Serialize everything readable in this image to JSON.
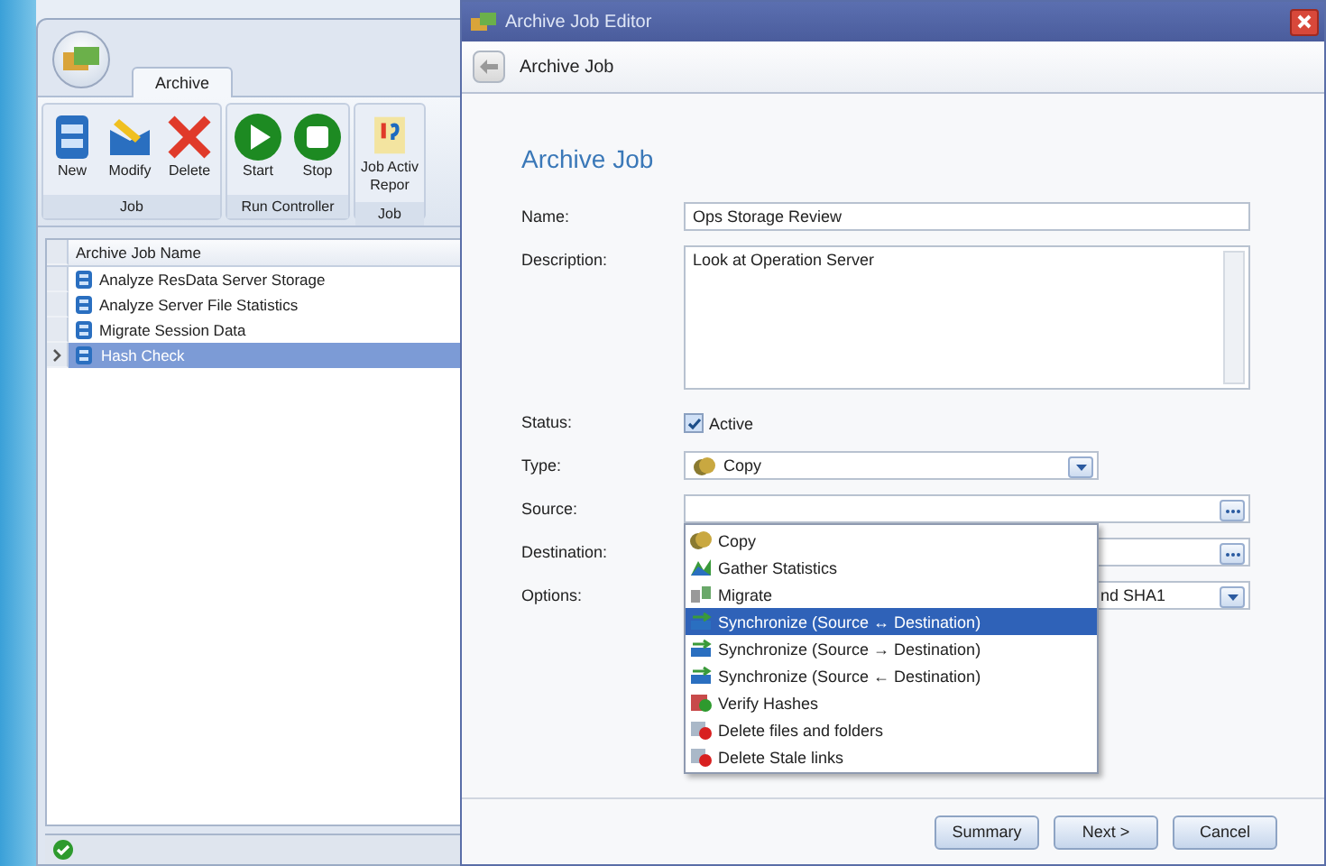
{
  "main_window": {
    "tab": {
      "label": "Archive",
      "selected": true
    },
    "ribbon_groups": [
      {
        "label": "Job",
        "buttons": [
          {
            "kind": "new",
            "lines": [
              "New"
            ]
          },
          {
            "kind": "modify",
            "lines": [
              "Modify"
            ]
          },
          {
            "kind": "delete",
            "lines": [
              "Delete"
            ]
          }
        ]
      },
      {
        "label": "Run Controller",
        "buttons": [
          {
            "kind": "start",
            "lines": [
              "Start"
            ]
          },
          {
            "kind": "stop",
            "lines": [
              "Stop"
            ]
          }
        ]
      },
      {
        "label": "Job",
        "buttons": [
          {
            "kind": "report",
            "lines": [
              "Job Activ",
              "Repor"
            ]
          }
        ]
      }
    ],
    "list": {
      "column": "Archive Job Name",
      "rows": [
        {
          "name": "Analyze ResData Server Storage",
          "selected": false
        },
        {
          "name": "Analyze Server File Statistics",
          "selected": false
        },
        {
          "name": "Migrate Session Data",
          "selected": false
        },
        {
          "name": "Hash Check",
          "selected": true
        }
      ]
    }
  },
  "dialog": {
    "title": "Archive Job Editor",
    "header": "Archive Job",
    "heading": "Archive Job",
    "fields": [
      {
        "kind": "text",
        "label": "Name:",
        "value": "Ops Storage Review"
      },
      {
        "kind": "textarea",
        "label": "Description:",
        "value": "Look at Operation Server"
      },
      {
        "kind": "checkbox",
        "label": "Status:",
        "option": "Active",
        "checked": true
      },
      {
        "kind": "select",
        "label": "Type:",
        "value": "Copy",
        "expanded": true
      },
      {
        "kind": "path",
        "label": "Source:"
      },
      {
        "kind": "path",
        "label": "Destination:"
      },
      {
        "kind": "select",
        "label": "Options:",
        "value": "nd SHA1",
        "expanded": false
      }
    ],
    "type_options": [
      {
        "kind": "copy",
        "label": "Copy",
        "selected": false
      },
      {
        "kind": "stats",
        "label": "Gather Statistics",
        "selected": false
      },
      {
        "kind": "migrate",
        "label": "Migrate",
        "selected": false
      },
      {
        "kind": "sync",
        "label": "Synchronize (Source ↔ Destination)",
        "selected": true
      },
      {
        "kind": "sync",
        "label": "Synchronize (Source → Destination)",
        "selected": false
      },
      {
        "kind": "sync",
        "label": "Synchronize (Source ← Destination)",
        "selected": false
      },
      {
        "kind": "verify",
        "label": "Verify Hashes",
        "selected": false
      },
      {
        "kind": "delete",
        "label": "Delete files and folders",
        "selected": false
      },
      {
        "kind": "delete",
        "label": "Delete Stale links",
        "selected": false
      }
    ],
    "buttons": [
      "Summary",
      "Next >",
      "Cancel"
    ]
  }
}
